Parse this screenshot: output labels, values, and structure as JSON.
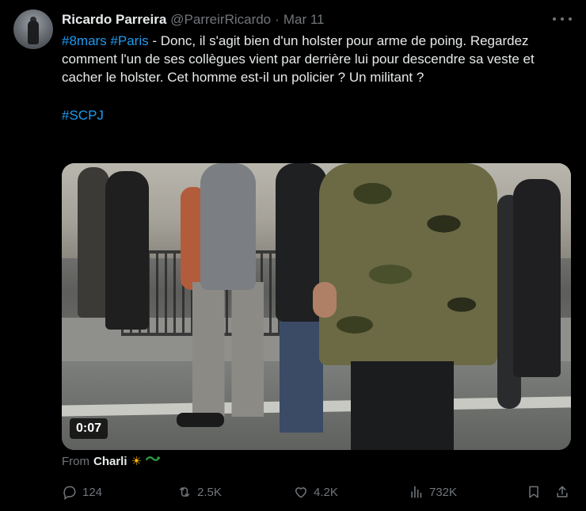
{
  "tweet": {
    "author_name": "Ricardo Parreira",
    "author_handle": "@ParreirRicardo",
    "separator": "·",
    "date": "Mar 11",
    "text": {
      "tag1": "#8mars",
      "tag2": "#Paris",
      "body": " - Donc, il s'agit bien d'un holster pour arme de poing. Regardez comment l'un de ses collègues vient par derrière lui pour descendre sa veste et cacher le holster. Cet homme est-il un policier ? Un militant ?",
      "tag3": "#SCPJ"
    },
    "video_timestamp": "0:07",
    "from_label": "From",
    "from_name": "Charli"
  },
  "actions": {
    "replies": "124",
    "reposts": "2.5K",
    "likes": "4.2K",
    "views": "732K"
  },
  "colors": {
    "background": "#000000",
    "text": "#e7e9ea",
    "muted": "#71767b",
    "link": "#1d9bf0"
  },
  "icons": [
    "more-icon",
    "reply-icon",
    "repost-icon",
    "like-icon",
    "views-icon",
    "bookmark-icon",
    "share-icon",
    "sun-icon",
    "lizard-icon"
  ]
}
